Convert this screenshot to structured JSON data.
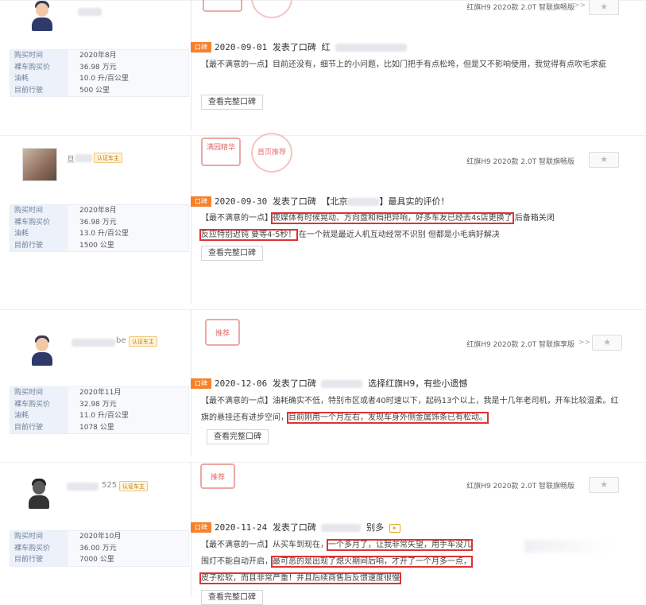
{
  "labels": {
    "buy_time": "购买时间",
    "price": "裸车购买价",
    "fuel": "油耗",
    "mileage": "目前行驶",
    "full_review": "查看完整口碑",
    "kb_tag": "口碑",
    "posted": "发表了口碑",
    "cert": "认证车主",
    "star": "★",
    "chevron": ">>"
  },
  "reviews": [
    {
      "buy_time": "2020年8月",
      "price": "36.98 万元",
      "fuel": "10.0 升/百公里",
      "mileage": "500 公里",
      "car": "红旗H9 2020款 2.0T 智联旗畅版",
      "date": "2020-09-01",
      "title_tail": "红",
      "text_pre": "【最不满意的一点】目前还没有，细节上的小问题，比如门把手有点松垮，但是又不影响使用，我觉得有点吹毛求疵"
    },
    {
      "buy_time": "2020年8月",
      "price": "36.98 万元",
      "fuel": "13.0 升/百公里",
      "mileage": "1500 公里",
      "car": "红旗H9 2020款 2.0T 智联旗畅版",
      "user": "旦",
      "badge1": "满园精华",
      "badge2": "首页推荐",
      "date": "2020-09-30",
      "title_tail": "【北京",
      "title_tail2": "】最具实的评价！",
      "text_a": "【最不满意的一点】",
      "text_b": "夜媒体有时候晃动、方向盘和档把异响，好多车友已经去4s店更换了",
      "text_c": "后备箱关闭",
      "text_d": "反应特别迟钝 要等4-5秒！",
      "text_e": "在一个就是最近人机互动经常不识别 但都是小毛病好解决"
    },
    {
      "buy_time": "2020年11月",
      "price": "32.98 万元",
      "fuel": "11.0 升/百公里",
      "mileage": "1078 公里",
      "car": "红旗H9 2020款 2.0T 智联旗享版",
      "user": "be",
      "badge1": "推荐",
      "date": "2020-12-06",
      "title_tail": "选择红旗H9，有些小遗憾",
      "text_a": "【最不满意的一点】油耗确实不低，特别市区或者40时速以下，起码13个以上，我是十几年老司机，开车比较温柔。红旗的悬挂还有进步空间，",
      "text_b": "目前刚用一个月左右，发现车身外侧金属饰条已有松动。"
    },
    {
      "buy_time": "2020年10月",
      "price": "36.00 万元",
      "mileage": "7000 公里",
      "car": "红旗H9 2020款 2.0T 智联旗畅版",
      "user": "525",
      "badge1": "推荐",
      "date": "2020-11-24",
      "title_tail": "别多",
      "text_a": "【最不满意的一点】从买车到现在，",
      "text_b": "一个多月了，让我非常失望，用手车没几",
      "text_c": "围灯不能自动开启，",
      "text_d": "最可恶的是出现了熄火期间后响，才开了一个月多一点，",
      "text_e": "皮子松软，而且非常严重！并且后续商售后反馈速度很慢"
    }
  ]
}
